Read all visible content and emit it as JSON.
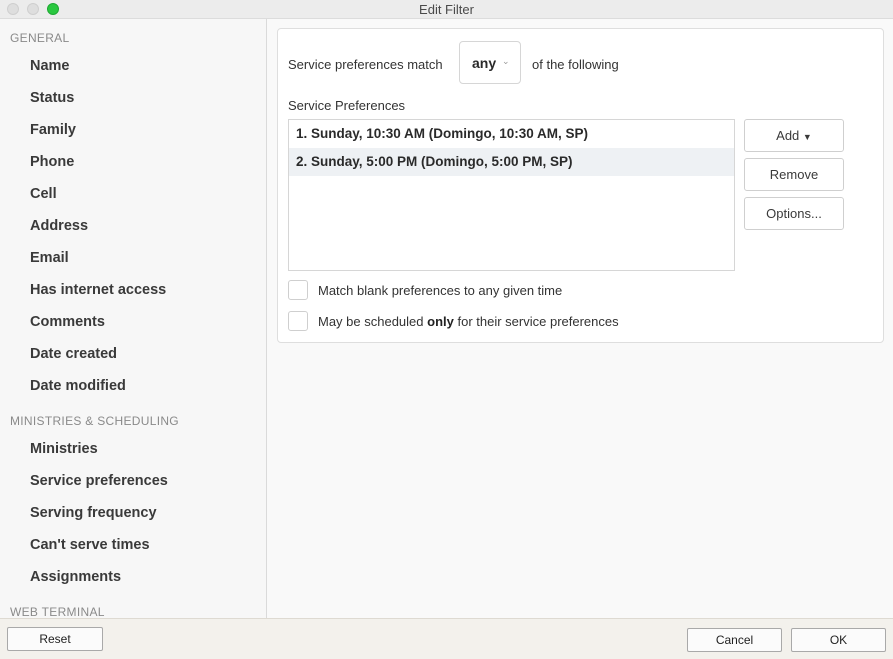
{
  "window": {
    "title": "Edit Filter"
  },
  "sidebar": {
    "sections": [
      {
        "label": "GENERAL",
        "items": [
          "Name",
          "Status",
          "Family",
          "Phone",
          "Cell",
          "Address",
          "Email",
          "Has internet access",
          "Comments",
          "Date created",
          "Date modified"
        ]
      },
      {
        "label": "MINISTRIES & SCHEDULING",
        "items": [
          "Ministries",
          "Service preferences",
          "Serving frequency",
          "Can't serve times",
          "Assignments"
        ]
      },
      {
        "label": "WEB TERMINAL",
        "items": []
      }
    ]
  },
  "filter": {
    "match_prefix": "Service preferences match",
    "match_value": "any",
    "match_suffix": "of the following",
    "list_label": "Service Preferences",
    "preferences": [
      "1. Sunday, 10:30 AM (Domingo, 10:30 AM, SP)",
      "2. Sunday, 5:00 PM (Domingo, 5:00 PM, SP)"
    ],
    "selected_index": 1,
    "add_label": "Add",
    "remove_label": "Remove",
    "options_label": "Options...",
    "checkbox_blank_label": "Match blank preferences to any given time",
    "checkbox_only_prefix": "May be scheduled",
    "checkbox_only_bold": "only",
    "checkbox_only_suffix": "for their service preferences"
  },
  "footer": {
    "reset_label": "Reset",
    "cancel_label": "Cancel",
    "ok_label": "OK"
  },
  "colors": {
    "zoom_button": "#2ac840",
    "selection_row": "#eef1f4"
  },
  "icons": {
    "dropdown": "chevron-down-icon",
    "add_menu": "caret-down-icon"
  }
}
